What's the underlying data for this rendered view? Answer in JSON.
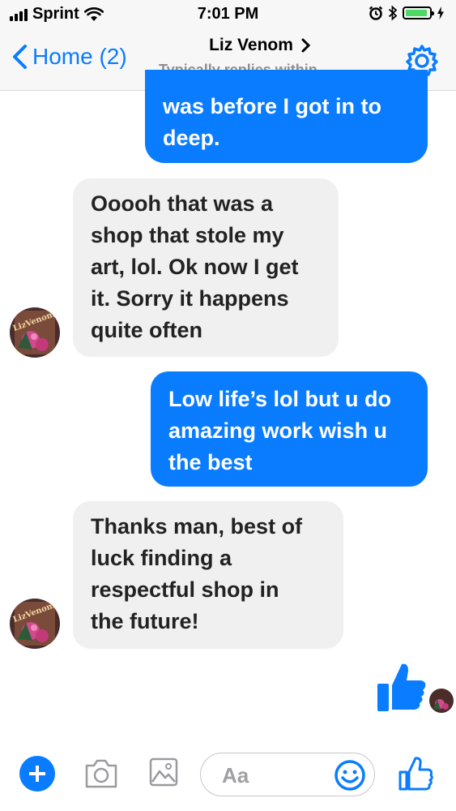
{
  "status_bar": {
    "carrier": "Sprint",
    "time": "7:01 PM"
  },
  "nav": {
    "back_label": "Home (2)",
    "contact_name": "Liz Venom",
    "subtitle": "Typically replies within..."
  },
  "messages": [
    {
      "direction": "out",
      "text": "was before I got in to\ndeep."
    },
    {
      "direction": "in",
      "text": "Ooooh that was a\nshop that stole my\nart, lol. Ok now I get\nit. Sorry it happens\nquite often"
    },
    {
      "direction": "out",
      "text": "Low life’s lol but u do\namazing work wish u\nthe best"
    },
    {
      "direction": "in",
      "text": "Thanks man, best of\nluck finding a\nrespectful shop in\nthe future!"
    }
  ],
  "avatar_text": "LizVenom",
  "composer": {
    "placeholder": "Aa"
  },
  "colors": {
    "accent": "#0a7cff",
    "incoming_bubble": "#f1f0f0",
    "battery": "#4cd964"
  },
  "icons": [
    "wifi-icon",
    "alarm-icon",
    "bluetooth-icon",
    "battery-icon",
    "back-chevron-icon",
    "gear-icon",
    "thumbs-up-icon",
    "plus-icon",
    "camera-icon",
    "gallery-icon",
    "smiley-icon"
  ]
}
